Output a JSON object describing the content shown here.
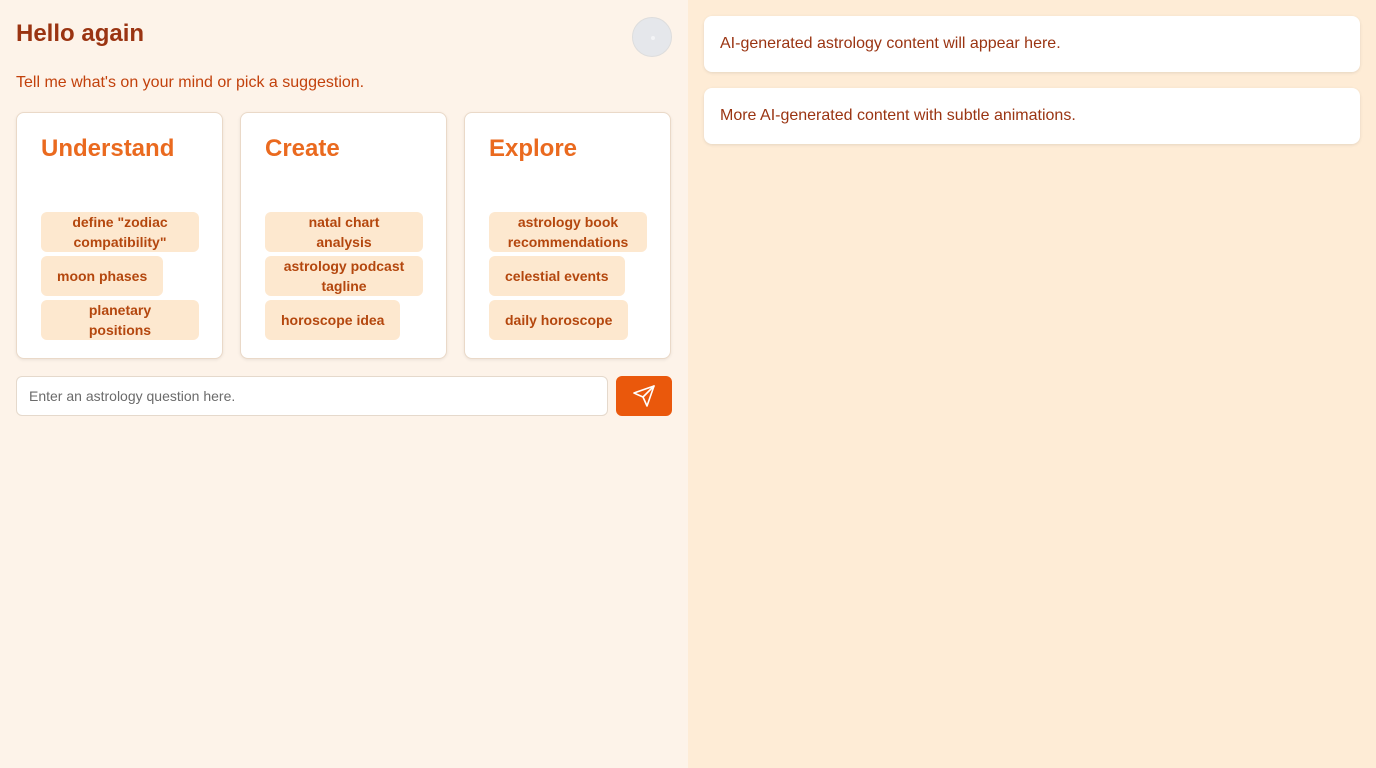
{
  "header": {
    "title": "Hello again",
    "subtitle": "Tell me what's on your mind or pick a suggestion."
  },
  "cards": [
    {
      "title": "Understand",
      "chips": [
        "define \"zodiac compatibility\"",
        "moon phases",
        "planetary positions"
      ]
    },
    {
      "title": "Create",
      "chips": [
        "natal chart analysis",
        "astrology podcast tagline",
        "horoscope idea"
      ]
    },
    {
      "title": "Explore",
      "chips": [
        "astrology book recommendations",
        "celestial events",
        "daily horoscope"
      ]
    }
  ],
  "input": {
    "placeholder": "Enter an astrology question here.",
    "value": ""
  },
  "panels": [
    "AI-generated astrology content will appear here.",
    "More AI-generated content with subtle animations."
  ],
  "colors": {
    "accent": "#ea580c",
    "heading": "#9a3412",
    "chip_bg": "#fde8cf"
  },
  "icons": {
    "send": "send-icon",
    "avatar": "avatar"
  }
}
